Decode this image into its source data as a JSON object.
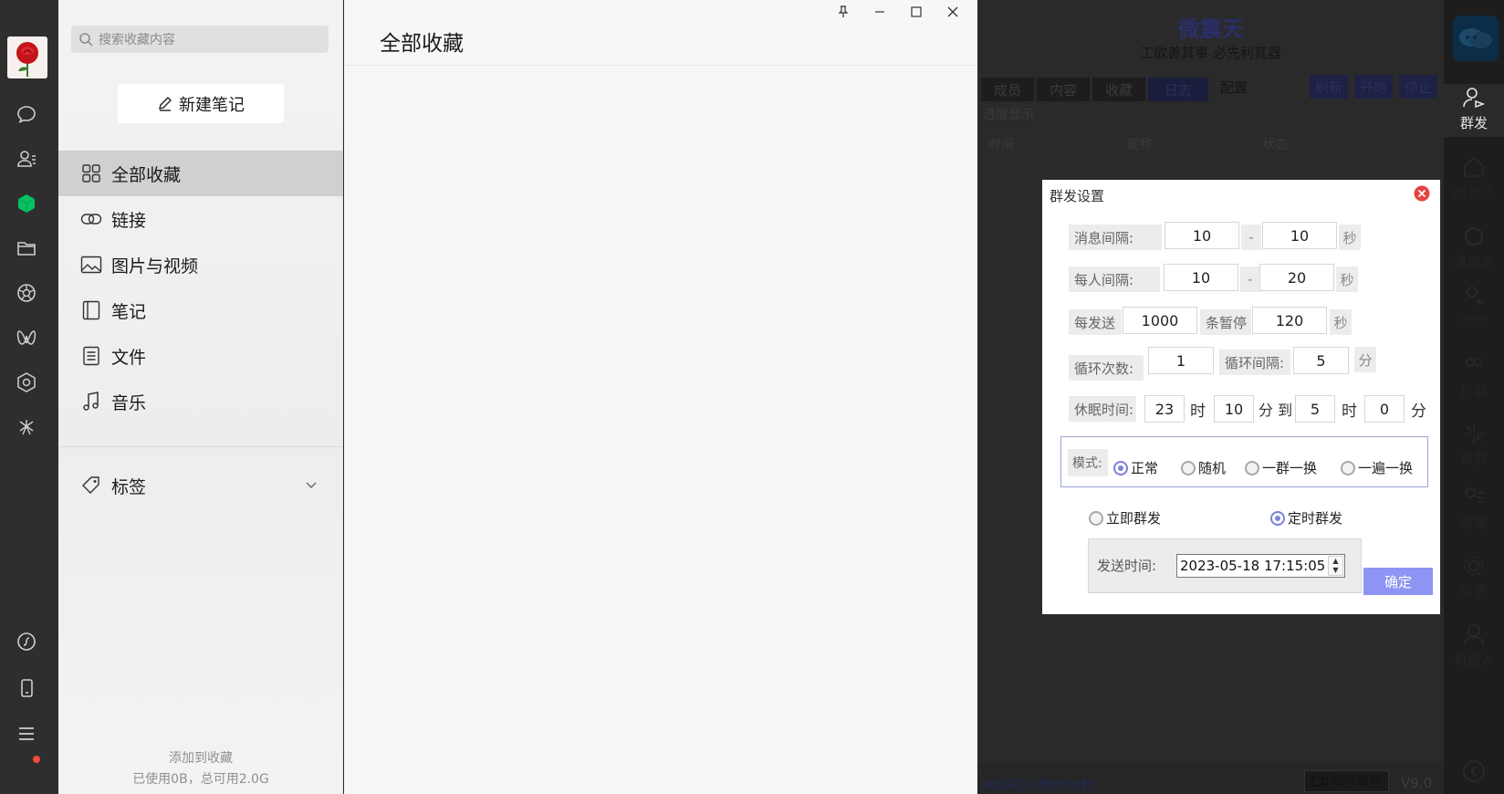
{
  "nav": {
    "search_placeholder": "搜索收藏内容",
    "new_note_label": "新建笔记",
    "items": [
      {
        "label": "全部收藏",
        "icon": "grid-icon"
      },
      {
        "label": "链接",
        "icon": "link-icon"
      },
      {
        "label": "图片与视频",
        "icon": "image-icon"
      },
      {
        "label": "笔记",
        "icon": "notebook-icon"
      },
      {
        "label": "文件",
        "icon": "file-icon"
      },
      {
        "label": "音乐",
        "icon": "music-icon"
      }
    ],
    "tags_label": "标签",
    "footer_add": "添加到收藏",
    "footer_usage": "已使用0B，总可用2.0G"
  },
  "main": {
    "title": "全部收藏"
  },
  "bg_app": {
    "title": "微震天",
    "slogan": "工欲善其事 必先利其器",
    "tabs": [
      "成员",
      "内容",
      "收藏",
      "日志",
      "配置"
    ],
    "buttons": [
      "刷新",
      "开始",
      "停止"
    ],
    "progress_label": "进度显示",
    "columns": [
      "时间",
      "昵称",
      "状态"
    ],
    "uptime": "366天0小时0分0秒",
    "tutorial_label": "视频教程",
    "version": "V9.0",
    "side_items": [
      "群发",
      "朋友圈",
      "通讯录",
      "添加",
      "拉群",
      "换群",
      "客服",
      "设置",
      "机器人"
    ]
  },
  "dialog": {
    "title": "群发设置",
    "msg_interval_label": "消息间隔:",
    "msg_interval_min": "10",
    "msg_interval_max": "10",
    "person_interval_label": "每人间隔:",
    "person_interval_min": "10",
    "person_interval_max": "20",
    "dash": "-",
    "unit_sec": "秒",
    "per_send_label": "每发送",
    "per_send_value": "1000",
    "pause_label": "条暂停",
    "pause_value": "120",
    "loop_count_label": "循环次数:",
    "loop_count_value": "1",
    "loop_interval_label": "循环间隔:",
    "loop_interval_value": "5",
    "unit_min": "分",
    "sleep_label": "休眠时间:",
    "sleep_from_h": "23",
    "unit_hour": "时",
    "sleep_from_m": "10",
    "unit_to": "分 到",
    "sleep_to_h": "5",
    "sleep_to_m": "0",
    "mode_label": "模式:",
    "modes": [
      "正常",
      "随机",
      "一群一换",
      "一遍一换"
    ],
    "selected_mode": "正常",
    "send_now_label": "立即群发",
    "send_timed_label": "定时群发",
    "selected_send": "定时群发",
    "send_time_label": "发送时间:",
    "send_time_value": "2023-05-18 17:15:05",
    "ok_label": "确定"
  }
}
